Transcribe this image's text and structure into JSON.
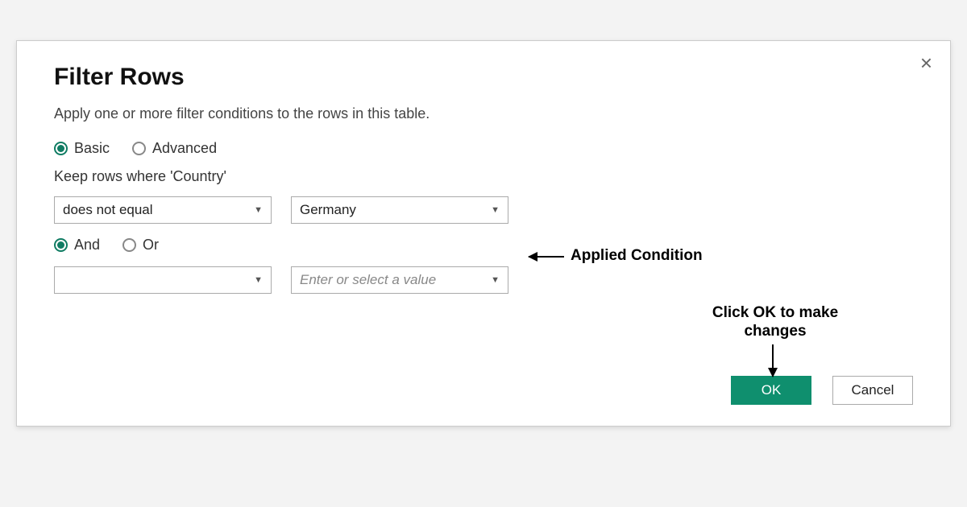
{
  "dialog": {
    "title": "Filter Rows",
    "subtitle": "Apply one or more filter conditions to the rows in this table.",
    "close_icon": "×",
    "mode": {
      "basic": "Basic",
      "advanced": "Advanced",
      "selected": "basic"
    },
    "keep_label": "Keep rows where 'Country'",
    "conditions": [
      {
        "operator": "does not equal",
        "value": "Germany"
      },
      {
        "operator": "",
        "value_placeholder": "Enter or select a value"
      }
    ],
    "logic": {
      "and": "And",
      "or": "Or",
      "selected": "and"
    },
    "buttons": {
      "ok": "OK",
      "cancel": "Cancel"
    }
  },
  "annotations": {
    "applied_condition": "Applied Condition",
    "click_ok": "Click OK to make changes"
  }
}
